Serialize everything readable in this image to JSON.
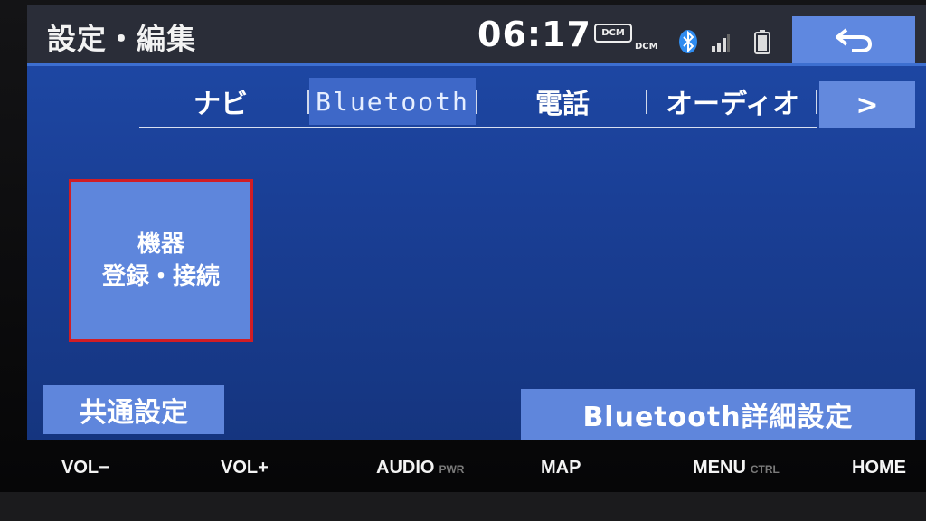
{
  "status": {
    "title": "設定・編集",
    "clock": "06:17",
    "dcm_badge": "DCM",
    "dcm_text": "DCM",
    "icons": [
      "bluetooth-icon",
      "signal-icon",
      "battery-icon",
      "back-arrow-icon"
    ]
  },
  "tabs": {
    "items": [
      {
        "label": "ナビ"
      },
      {
        "label": "Bluetooth"
      },
      {
        "label": "電話"
      },
      {
        "label": "オーディオ"
      }
    ],
    "active": "Bluetooth",
    "next_label": ">"
  },
  "tiles": {
    "device_line1": "機器",
    "device_line2": "登録・接続"
  },
  "footer": {
    "common_label": "共通設定",
    "bt_detail_label": "Bluetooth詳細設定"
  },
  "hardware": {
    "vol_minus": "VOL−",
    "vol_plus": "VOL+",
    "audio": "AUDIO",
    "audio_sub": "PWR",
    "map": "MAP",
    "menu": "MENU",
    "menu_sub": "CTRL",
    "home": "HOME"
  },
  "colors": {
    "screen_bg": "#1a3f96",
    "tile_bg": "#5e86dc",
    "selected_border": "#d11d24",
    "active_tab": "#3e68c8"
  }
}
